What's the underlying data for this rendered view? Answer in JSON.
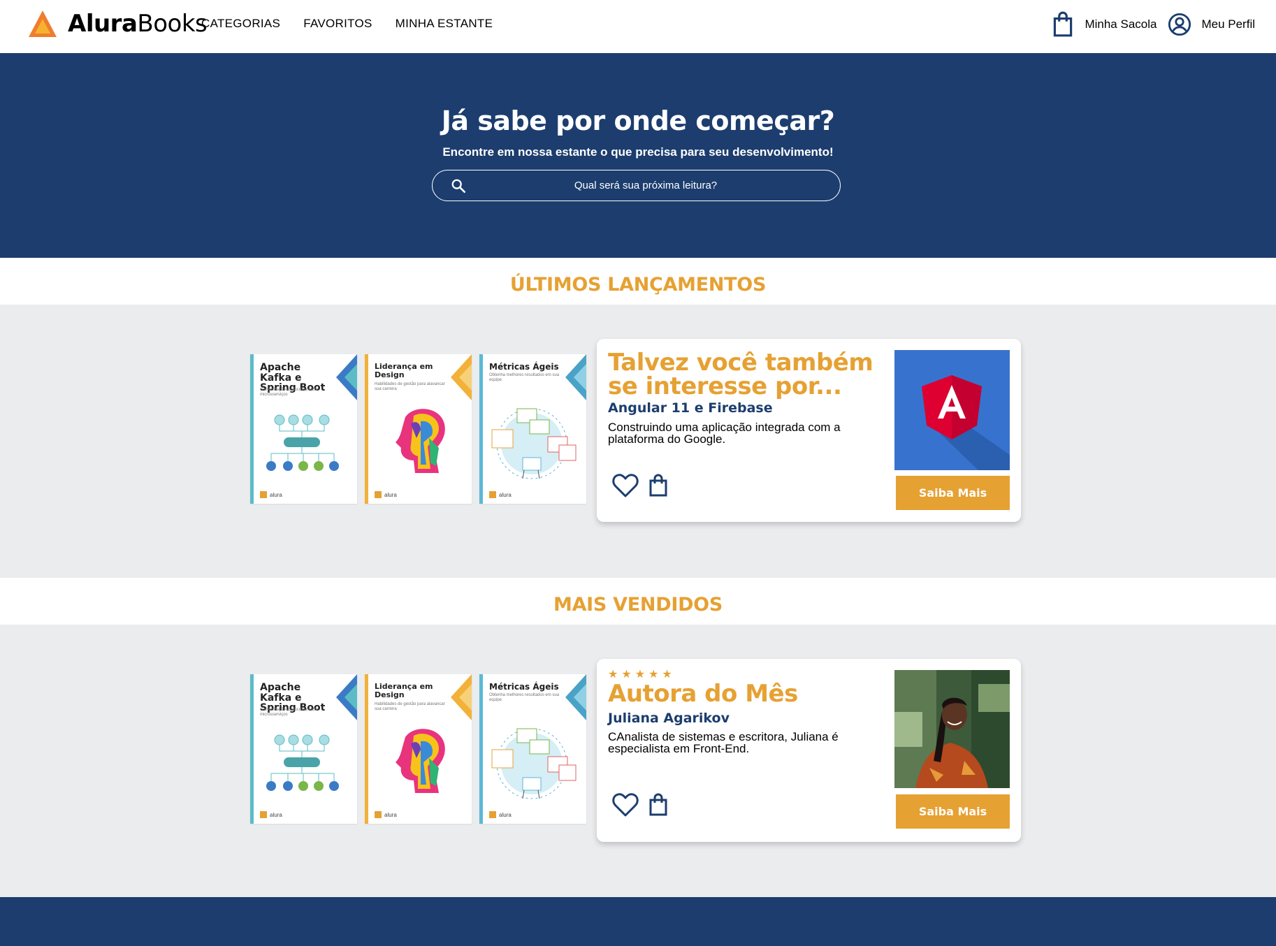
{
  "header": {
    "logo_bold": "Alura",
    "logo_light": "Books",
    "nav": [
      "CATEGORIAS",
      "FAVORITOS",
      "MINHA ESTANTE"
    ],
    "bag_label": "Minha Sacola",
    "profile_label": "Meu Perfil"
  },
  "hero": {
    "title": "Já sabe por onde começar?",
    "subtitle": "Encontre em nossa estante o que precisa para seu desenvolvimento!",
    "search_placeholder": "Qual será sua próxima leitura?"
  },
  "sections": [
    {
      "title": "ÚLTIMOS LANÇAMENTOS",
      "card": {
        "heading": "Talvez você também se interesse por...",
        "name": "Angular 11 e Firebase",
        "description": "Construindo uma aplicação integrada com a plataforma do Google.",
        "button": "Saiba Mais",
        "image": "angular-logo"
      }
    },
    {
      "title": "MAIS VENDIDOS",
      "card": {
        "rating": 5,
        "stars": "★★★★★",
        "heading": "Autora do Mês",
        "name": "Juliana Agarikov",
        "description": "CAnalista de sistemas e escritora, Juliana é especialista em Front-End.",
        "button": "Saiba Mais",
        "image": "author-photo"
      }
    }
  ],
  "books": [
    {
      "title": "Apache Kafka e Spring Boot",
      "subtitle": "Comunicação assíncrona entre microsserviços",
      "accent": "#5bbcc6",
      "art": "kafka-diagram"
    },
    {
      "title": "Liderança em Design",
      "subtitle": "Habilidades de gestão para alavancar sua carreira",
      "accent": "#f2b138",
      "art": "colorful-head"
    },
    {
      "title": "Métricas Ágeis",
      "subtitle": "Obtenha melhores resultados em sua equipe",
      "accent": "#5bb8d8",
      "art": "metrics-cycle"
    }
  ],
  "book_footer": "alura",
  "colors": {
    "navy": "#1c3d6e",
    "accent": "#e6a133",
    "shelf_bg": "#ebecee"
  }
}
